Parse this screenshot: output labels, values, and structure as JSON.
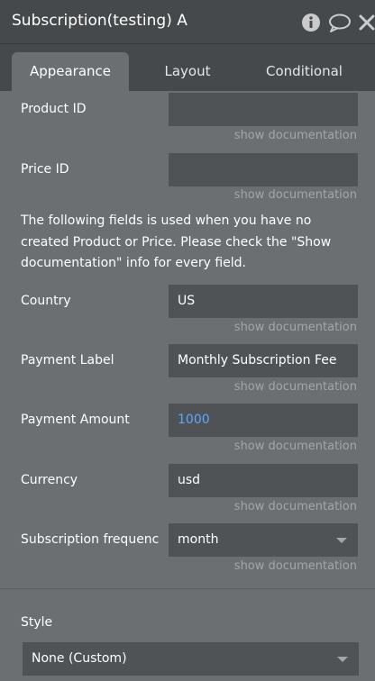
{
  "header": {
    "title": "Subscription(testing) A",
    "icons": [
      "info-icon",
      "comment-icon",
      "close-icon"
    ]
  },
  "tabs": [
    {
      "label": "Appearance",
      "active": true
    },
    {
      "label": "Layout",
      "active": false
    },
    {
      "label": "Conditional",
      "active": false
    }
  ],
  "fields": {
    "product_id": {
      "label": "Product ID",
      "value": "",
      "doc": "show documentation"
    },
    "price_id": {
      "label": "Price ID",
      "value": "",
      "doc": "show documentation"
    },
    "info_text": "The following fields is used when you have no created Product or Price. Please check the \"Show documentation\" info for every field.",
    "country": {
      "label": "Country",
      "value": "US",
      "doc": "show documentation"
    },
    "payment_label": {
      "label": "Payment Label",
      "value": "Monthly Subscription Fee",
      "doc": "show documentation"
    },
    "payment_amount": {
      "label": "Payment Amount",
      "value": "1000",
      "doc": "show documentation"
    },
    "currency": {
      "label": "Currency",
      "value": "usd",
      "doc": "show documentation"
    },
    "subscription_frequency": {
      "label": "Subscription frequenc",
      "value": "month",
      "doc": "show documentation"
    }
  },
  "style": {
    "label": "Style",
    "value": "None (Custom)"
  },
  "colors": {
    "panel": "#6b6f72",
    "header": "#46494b",
    "field": "#505356",
    "number": "#5aa8ff",
    "muted": "#a3a6a9"
  }
}
